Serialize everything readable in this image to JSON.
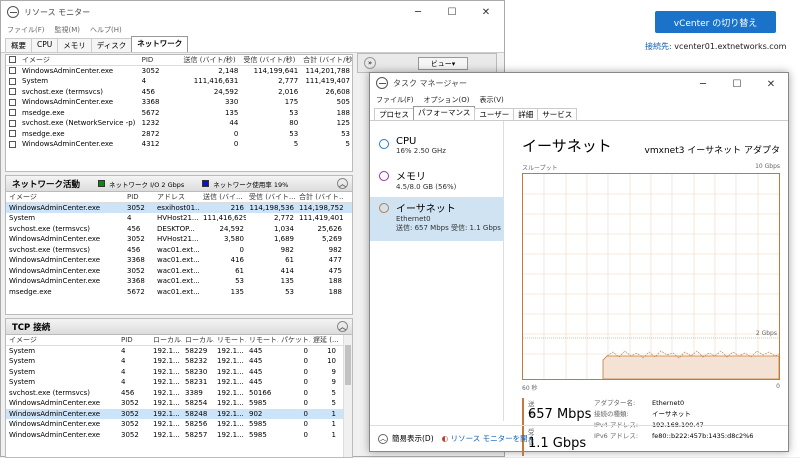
{
  "background": {
    "vcenter_button": "vCenter の切り替え",
    "connection_label": "接続先:",
    "connection_host": "vcenter01.extnetworks.com"
  },
  "resource_monitor": {
    "title": "リソース モニター",
    "menu": [
      "ファイル(F)",
      "監視(M)",
      "ヘルプ(H)"
    ],
    "tabs": [
      "概要",
      "CPU",
      "メモリ",
      "ディスク",
      "ネットワーク"
    ],
    "active_tab": "ネットワーク",
    "view_button": "ビュー",
    "processes": {
      "headers": [
        "イメージ",
        "PID",
        "送信 (バイト/秒)",
        "受信 (バイト/秒)",
        "合計 (バイト/秒)"
      ],
      "rows": [
        [
          "WindowsAdminCenter.exe",
          "3052",
          "2,148",
          "114,199,641",
          "114,201,788"
        ],
        [
          "System",
          "4",
          "111,416,631",
          "2,777",
          "111,419,407"
        ],
        [
          "svchost.exe (termsvcs)",
          "456",
          "24,592",
          "2,016",
          "26,608"
        ],
        [
          "WindowsAdminCenter.exe",
          "3368",
          "330",
          "175",
          "505"
        ],
        [
          "msedge.exe",
          "5672",
          "135",
          "53",
          "188"
        ],
        [
          "svchost.exe (NetworkService -p)",
          "1232",
          "44",
          "80",
          "125"
        ],
        [
          "msedge.exe",
          "2872",
          "0",
          "53",
          "53"
        ],
        [
          "WindowsAdminCenter.exe",
          "4312",
          "0",
          "5",
          "5"
        ]
      ]
    },
    "network_activity": {
      "title": "ネットワーク活動",
      "legend_io": "ネットワーク I/O 2 Gbps",
      "legend_util": "ネットワーク使用率 19%",
      "io_color": "#0a8a0a",
      "util_color": "#1010c8",
      "headers": [
        "イメージ",
        "PID",
        "アドレス",
        "送信 (バイ...",
        "受信 (バイト...",
        "合計 (バイト..."
      ],
      "rows": [
        [
          "WindowsAdminCenter.exe",
          "3052",
          "esxihost01...",
          "216",
          "114,198,536",
          "114,198,752"
        ],
        [
          "System",
          "4",
          "HVHost21...",
          "111,416,629",
          "2,772",
          "111,419,401"
        ],
        [
          "svchost.exe (termsvcs)",
          "456",
          "DESKTOP...",
          "24,592",
          "1,034",
          "25,626"
        ],
        [
          "WindowsAdminCenter.exe",
          "3052",
          "HVHost21...",
          "3,580",
          "1,689",
          "5,269"
        ],
        [
          "svchost.exe (termsvcs)",
          "456",
          "wac01.ext...",
          "0",
          "982",
          "982"
        ],
        [
          "WindowsAdminCenter.exe",
          "3368",
          "wac01.ext...",
          "416",
          "61",
          "477"
        ],
        [
          "WindowsAdminCenter.exe",
          "3052",
          "wac01.ext...",
          "61",
          "414",
          "475"
        ],
        [
          "WindowsAdminCenter.exe",
          "3368",
          "wac01.ext...",
          "53",
          "135",
          "188"
        ],
        [
          "msedge.exe",
          "5672",
          "wac01.ext...",
          "135",
          "53",
          "188"
        ]
      ]
    },
    "tcp": {
      "title": "TCP 接続",
      "headers": [
        "イメージ",
        "PID",
        "ローカル...",
        "ローカル...",
        "リモート...",
        "リモート...",
        "パケット...",
        "遅延 (..."
      ],
      "rows": [
        [
          "System",
          "4",
          "192.1...",
          "58229",
          "192.1...",
          "445",
          "0",
          "10"
        ],
        [
          "System",
          "4",
          "192.1...",
          "58232",
          "192.1...",
          "445",
          "0",
          "10"
        ],
        [
          "System",
          "4",
          "192.1...",
          "58230",
          "192.1...",
          "445",
          "0",
          "9"
        ],
        [
          "System",
          "4",
          "192.1...",
          "58231",
          "192.1...",
          "445",
          "0",
          "9"
        ],
        [
          "svchost.exe (termsvcs)",
          "456",
          "192.1...",
          "3389",
          "192.1...",
          "50166",
          "0",
          "5"
        ],
        [
          "WindowsAdminCenter.exe",
          "3052",
          "192.1...",
          "58254",
          "192.1...",
          "5985",
          "0",
          "5"
        ],
        [
          "WindowsAdminCenter.exe",
          "3052",
          "192.1...",
          "58248",
          "192.1...",
          "902",
          "0",
          "1"
        ],
        [
          "WindowsAdminCenter.exe",
          "3052",
          "192.1...",
          "58256",
          "192.1...",
          "5985",
          "0",
          "1"
        ],
        [
          "WindowsAdminCenter.exe",
          "3052",
          "192.1...",
          "58257",
          "192.1...",
          "5985",
          "0",
          "1"
        ]
      ]
    }
  },
  "task_manager": {
    "title": "タスク マネージャー",
    "menu": [
      "ファイル(F)",
      "オプション(O)",
      "表示(V)"
    ],
    "tabs": [
      "プロセス",
      "パフォーマンス",
      "ユーザー",
      "詳細",
      "サービス"
    ],
    "active_tab": "パフォーマンス",
    "sidebar": [
      {
        "name": "CPU",
        "detail": "16%  2.50 GHz",
        "color": "#1f7fd1"
      },
      {
        "name": "メモリ",
        "detail": "4.5/8.0 GB (56%)",
        "color": "#9b2fae"
      },
      {
        "name": "イーサネット",
        "detail": "Ethernet0",
        "detail2": "送信: 657 Mbps 受信: 1.1 Gbps",
        "color": "#c27a3a"
      }
    ],
    "heading": "イーサネット",
    "adapter_name": "vmxnet3 イーサネット アダプタ",
    "graph": {
      "throughput_label": "スループット",
      "max_label": "10 Gbps",
      "mid_label": "2 Gbps",
      "time_left": "60 秒",
      "time_right": "0"
    },
    "stats": {
      "send_label": "送信",
      "send_value": "657 Mbps",
      "recv_label": "受信",
      "recv_value": "1.1 Gbps",
      "adapter_label": "アダプター名:",
      "adapter_value": "Ethernet0",
      "conn_type_label": "接続の種類:",
      "conn_type_value": "イーサネット",
      "ipv4_label": "IPv4 アドレス:",
      "ipv4_value": "192.168.100.47",
      "ipv6_label": "IPv6 アドレス:",
      "ipv6_value": "fe80::b222:457b:1435:d8c2%6"
    },
    "footer": {
      "fewer_details": "簡易表示(D)",
      "open_resmon": "リソース モニターを開く"
    }
  }
}
